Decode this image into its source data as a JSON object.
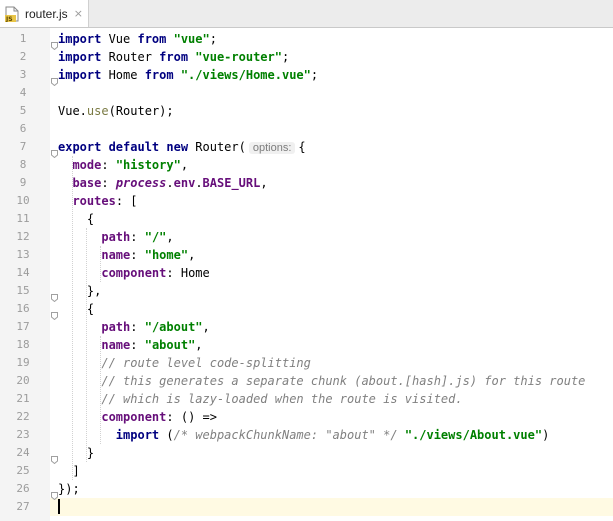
{
  "tab": {
    "title": "router.js",
    "icon": "js-file-icon",
    "icon_badge": "JS",
    "close_glyph": "×"
  },
  "editor": {
    "current_line": 27,
    "line_numbers": [
      "1",
      "2",
      "3",
      "4",
      "5",
      "6",
      "7",
      "8",
      "9",
      "10",
      "11",
      "12",
      "13",
      "14",
      "15",
      "16",
      "17",
      "18",
      "19",
      "20",
      "21",
      "22",
      "23",
      "24",
      "25",
      "26",
      "27"
    ],
    "lines": [
      [
        [
          "kw",
          "import"
        ],
        [
          "",
          "Vue "
        ],
        [
          "kw",
          "from"
        ],
        [
          "",
          ""
        ],
        [
          "str",
          "\"vue\""
        ],
        [
          "",
          ";"
        ]
      ],
      [
        [
          "kw",
          "import"
        ],
        [
          "",
          "Router "
        ],
        [
          "kw",
          "from"
        ],
        [
          "",
          ""
        ],
        [
          "str",
          "\"vue-router\""
        ],
        [
          "",
          ";"
        ]
      ],
      [
        [
          "kw",
          "import"
        ],
        [
          "",
          "Home "
        ],
        [
          "kw",
          "from"
        ],
        [
          "",
          ""
        ],
        [
          "str",
          "\"./views/Home.vue\""
        ],
        [
          "",
          ";"
        ]
      ],
      [],
      [
        [
          "",
          "Vue."
        ],
        [
          "fn",
          "use"
        ],
        [
          "",
          "(Router);"
        ]
      ],
      [],
      [
        [
          "kw",
          "export"
        ],
        [
          "",
          ""
        ],
        [
          "kw",
          "default"
        ],
        [
          "",
          ""
        ],
        [
          "kw",
          "new"
        ],
        [
          "",
          "Router("
        ],
        [
          "hint",
          "options:"
        ],
        [
          "",
          "{"
        ]
      ],
      [
        [
          "",
          "  "
        ],
        [
          "prop",
          "mode"
        ],
        [
          "",
          ": "
        ],
        [
          "str",
          "\"history\""
        ],
        [
          "",
          ","
        ]
      ],
      [
        [
          "",
          "  "
        ],
        [
          "prop",
          "base"
        ],
        [
          "",
          ": "
        ],
        [
          "it",
          "process"
        ],
        [
          "",
          "."
        ],
        [
          "prop",
          "env"
        ],
        [
          "",
          "."
        ],
        [
          "prop",
          "BASE_URL"
        ],
        [
          "",
          ","
        ]
      ],
      [
        [
          "",
          "  "
        ],
        [
          "prop",
          "routes"
        ],
        [
          "",
          ": ["
        ]
      ],
      [
        [
          "",
          "    {"
        ]
      ],
      [
        [
          "",
          "      "
        ],
        [
          "prop",
          "path"
        ],
        [
          "",
          ": "
        ],
        [
          "str",
          "\"/\""
        ],
        [
          "",
          ","
        ]
      ],
      [
        [
          "",
          "      "
        ],
        [
          "prop",
          "name"
        ],
        [
          "",
          ": "
        ],
        [
          "str",
          "\"home\""
        ],
        [
          "",
          ","
        ]
      ],
      [
        [
          "",
          "      "
        ],
        [
          "prop",
          "component"
        ],
        [
          "",
          ": Home"
        ]
      ],
      [
        [
          "",
          "    },"
        ]
      ],
      [
        [
          "",
          "    {"
        ]
      ],
      [
        [
          "",
          "      "
        ],
        [
          "prop",
          "path"
        ],
        [
          "",
          ": "
        ],
        [
          "str",
          "\"/about\""
        ],
        [
          "",
          ","
        ]
      ],
      [
        [
          "",
          "      "
        ],
        [
          "prop",
          "name"
        ],
        [
          "",
          ": "
        ],
        [
          "str",
          "\"about\""
        ],
        [
          "",
          ","
        ]
      ],
      [
        [
          "",
          "      "
        ],
        [
          "cmt",
          "// route level code-splitting"
        ]
      ],
      [
        [
          "",
          "      "
        ],
        [
          "cmt",
          "// this generates a separate chunk (about.[hash].js) for this route"
        ]
      ],
      [
        [
          "",
          "      "
        ],
        [
          "cmt",
          "// which is lazy-loaded when the route is visited."
        ]
      ],
      [
        [
          "",
          "      "
        ],
        [
          "prop",
          "component"
        ],
        [
          "",
          ": () =>"
        ]
      ],
      [
        [
          "",
          "        "
        ],
        [
          "kw",
          "import"
        ],
        [
          "",
          "("
        ],
        [
          "cmt",
          "/* webpackChunkName: \"about\" */"
        ],
        [
          "",
          ""
        ],
        [
          "str",
          "\"./views/About.vue\""
        ],
        [
          "",
          ")"
        ]
      ],
      [
        [
          "",
          "    }"
        ]
      ],
      [
        [
          "",
          "  ]"
        ]
      ],
      [
        [
          "",
          "});"
        ]
      ],
      []
    ]
  }
}
